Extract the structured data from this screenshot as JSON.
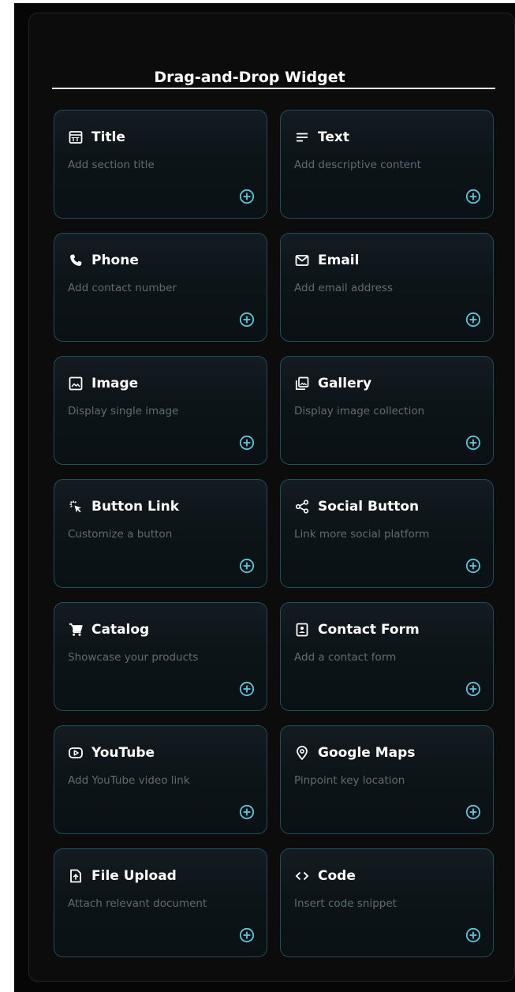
{
  "widget": {
    "title": "Drag-and-Drop Widget",
    "accent_color": "#5cc6dc",
    "card_border_color": "#1f4d5b",
    "items": [
      {
        "title": "Title",
        "description": "Add section title",
        "icon": "title-icon"
      },
      {
        "title": "Text",
        "description": "Add descriptive content",
        "icon": "text-icon"
      },
      {
        "title": "Phone",
        "description": "Add contact number",
        "icon": "phone-icon"
      },
      {
        "title": "Email",
        "description": "Add email address",
        "icon": "email-icon"
      },
      {
        "title": "Image",
        "description": "Display single image",
        "icon": "image-icon"
      },
      {
        "title": "Gallery",
        "description": "Display image collection",
        "icon": "gallery-icon"
      },
      {
        "title": "Button Link",
        "description": "Customize a button",
        "icon": "button-link-icon"
      },
      {
        "title": "Social Button",
        "description": "Link more social platform",
        "icon": "share-icon"
      },
      {
        "title": "Catalog",
        "description": "Showcase your products",
        "icon": "cart-icon"
      },
      {
        "title": "Contact Form",
        "description": "Add a contact form",
        "icon": "contact-form-icon"
      },
      {
        "title": "YouTube",
        "description": "Add YouTube video link",
        "icon": "youtube-icon"
      },
      {
        "title": "Google Maps",
        "description": "Pinpoint key location",
        "icon": "map-pin-icon"
      },
      {
        "title": "File Upload",
        "description": "Attach relevant document",
        "icon": "file-upload-icon"
      },
      {
        "title": "Code",
        "description": "Insert code snippet",
        "icon": "code-icon"
      }
    ]
  }
}
